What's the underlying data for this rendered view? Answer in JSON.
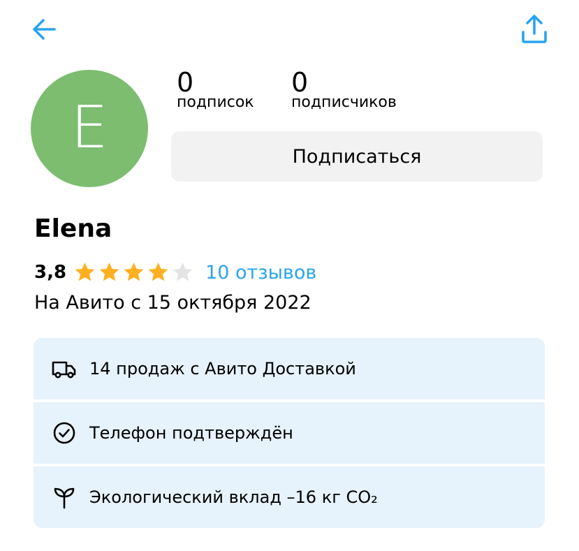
{
  "header": {
    "back_icon": "arrow-left-icon",
    "share_icon": "share-icon",
    "accent_color": "#2aa3ef"
  },
  "profile": {
    "avatar_letter": "E",
    "avatar_color": "#7cbd6f",
    "name": "Elena",
    "subscriptions_count": "0",
    "subscriptions_label": "подписок",
    "subscribers_count": "0",
    "subscribers_label": "подписчиков",
    "subscribe_label": "Подписаться"
  },
  "rating": {
    "value": "3,8",
    "stars_filled": 4,
    "stars_total": 5,
    "star_color": "#ffb021",
    "reviews_label": "10 отзывов"
  },
  "since_label": "На Авито с 15 октября 2022",
  "info": [
    {
      "icon": "truck-icon",
      "text": "14 продаж с Авито Доставкой"
    },
    {
      "icon": "check-circle-icon",
      "text": "Телефон подтверждён"
    },
    {
      "icon": "sprout-icon",
      "text": "Экологический вклад –16 кг CO₂"
    }
  ]
}
